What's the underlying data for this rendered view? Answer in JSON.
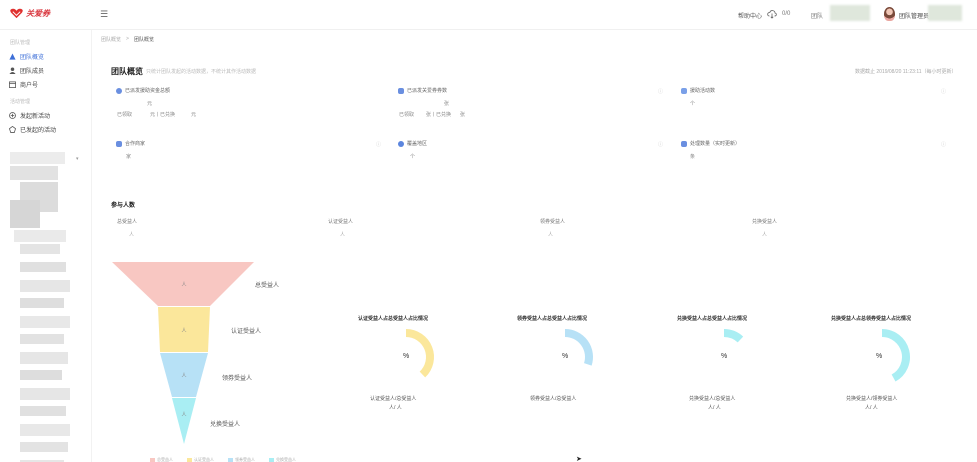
{
  "header": {
    "logo_text": "关爱券",
    "help": "帮助中心",
    "count": "0/0",
    "team": "团队",
    "user": "团队管理员"
  },
  "sidebar": {
    "group1": "团队管理",
    "items": [
      {
        "label": "团队概览",
        "icon": "triangle-icon",
        "active": true
      },
      {
        "label": "团队成员",
        "icon": "user-icon",
        "active": false
      },
      {
        "label": "商户号",
        "icon": "shop-icon",
        "active": false
      }
    ],
    "group2": "活动管理",
    "items2": [
      {
        "label": "发起新活动",
        "icon": "add-circle-icon"
      },
      {
        "label": "已发起的活动",
        "icon": "activity-icon"
      }
    ]
  },
  "breadcrumb": {
    "parent": "团队概览",
    "sep": ">",
    "current": "团队概览"
  },
  "page": {
    "title": "团队概览",
    "note": "只统计团队发起的活动数据，不统计其作活动数据",
    "stat_time": "数据截止 2019/08/20 11:23:11（每小时更新）"
  },
  "stats": [
    {
      "label": "已派发援助资金总额",
      "value": "元",
      "sub1": "已领取",
      "sub2": "元丨已兑换",
      "sub3": "元",
      "color": "#6a8fe0"
    },
    {
      "label": "已派发关爱券券数",
      "value": "张",
      "sub1": "已领取",
      "sub2": "张丨已兑换",
      "sub3": "张",
      "color": "#6a8fe0"
    },
    {
      "label": "援助活动数",
      "value": "个",
      "sub1": "",
      "sub2": "",
      "sub3": "",
      "color": "#7aa0e8"
    },
    {
      "label": "合作商家",
      "value": "家",
      "sub1": "",
      "sub2": "",
      "sub3": "",
      "color": "#6a8fe0"
    },
    {
      "label": "覆盖地区",
      "value": "个",
      "sub1": "",
      "sub2": "",
      "sub3": "",
      "color": "#5b85de"
    },
    {
      "label": "处理数量（实时更新）",
      "value": "条",
      "sub1": "",
      "sub2": "",
      "sub3": "",
      "color": "#6a8fe0"
    }
  ],
  "participants": {
    "title": "参与人数",
    "columns": [
      {
        "label": "总受益人",
        "value": "人"
      },
      {
        "label": "认证受益人",
        "value": "人"
      },
      {
        "label": "领券受益人",
        "value": "人"
      },
      {
        "label": "兑换受益人",
        "value": "人"
      }
    ]
  },
  "funnel": {
    "stages": [
      {
        "label": "总受益人",
        "value": "人",
        "color": "#f8c7c2"
      },
      {
        "label": "认证受益人",
        "value": "人",
        "color": "#fbe79b"
      },
      {
        "label": "领券受益人",
        "value": "人",
        "color": "#b7e1f6"
      },
      {
        "label": "兑换受益人",
        "value": "人",
        "color": "#a9eef3"
      }
    ],
    "legend": [
      "总受益人",
      "认证受益人",
      "领券受益人",
      "兑换受益人"
    ]
  },
  "rings": [
    {
      "title": "认证受益人占总受益人占比情况",
      "pct": "%",
      "caption": "认证受益人/总受益人",
      "value": "人/ 人",
      "color": "#fbe79b",
      "fraction": 0.38
    },
    {
      "title": "领券受益人占总受益人占比情况",
      "pct": "%",
      "caption": "领券受益人/总受益人",
      "value": "",
      "color": "#b7e1f6",
      "fraction": 0.3
    },
    {
      "title": "兑换受益人占总受益人占比情况",
      "pct": "%",
      "caption": "兑换受益人/总受益人",
      "value": "人/ 人",
      "color": "#a9eef3",
      "fraction": 0.12
    },
    {
      "title": "兑换受益人占总领券受益人占比情况",
      "pct": "%",
      "caption": "兑换受益人/领券受益人",
      "value": "人/ 人",
      "color": "#a9eef3",
      "fraction": 0.42
    }
  ]
}
